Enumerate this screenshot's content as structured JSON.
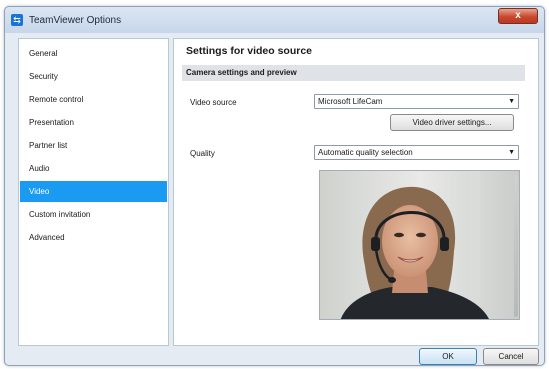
{
  "window": {
    "title": "TeamViewer Options",
    "close_label": "x"
  },
  "sidebar": {
    "items": [
      {
        "label": "General",
        "active": false
      },
      {
        "label": "Security",
        "active": false
      },
      {
        "label": "Remote control",
        "active": false
      },
      {
        "label": "Presentation",
        "active": false
      },
      {
        "label": "Partner list",
        "active": false
      },
      {
        "label": "Audio",
        "active": false
      },
      {
        "label": "Video",
        "active": true
      },
      {
        "label": "Custom invitation",
        "active": false
      },
      {
        "label": "Advanced",
        "active": false
      }
    ]
  },
  "content": {
    "title": "Settings for video source",
    "section": "Camera settings and preview",
    "video_source_label": "Video source",
    "video_source_value": "Microsoft LifeCam",
    "driver_button": "Video driver settings...",
    "quality_label": "Quality",
    "quality_value": "Automatic quality selection"
  },
  "footer": {
    "ok_label": "OK",
    "cancel_label": "Cancel"
  },
  "colors": {
    "selection": "#1a9af0",
    "close_button": "#c9472f"
  }
}
